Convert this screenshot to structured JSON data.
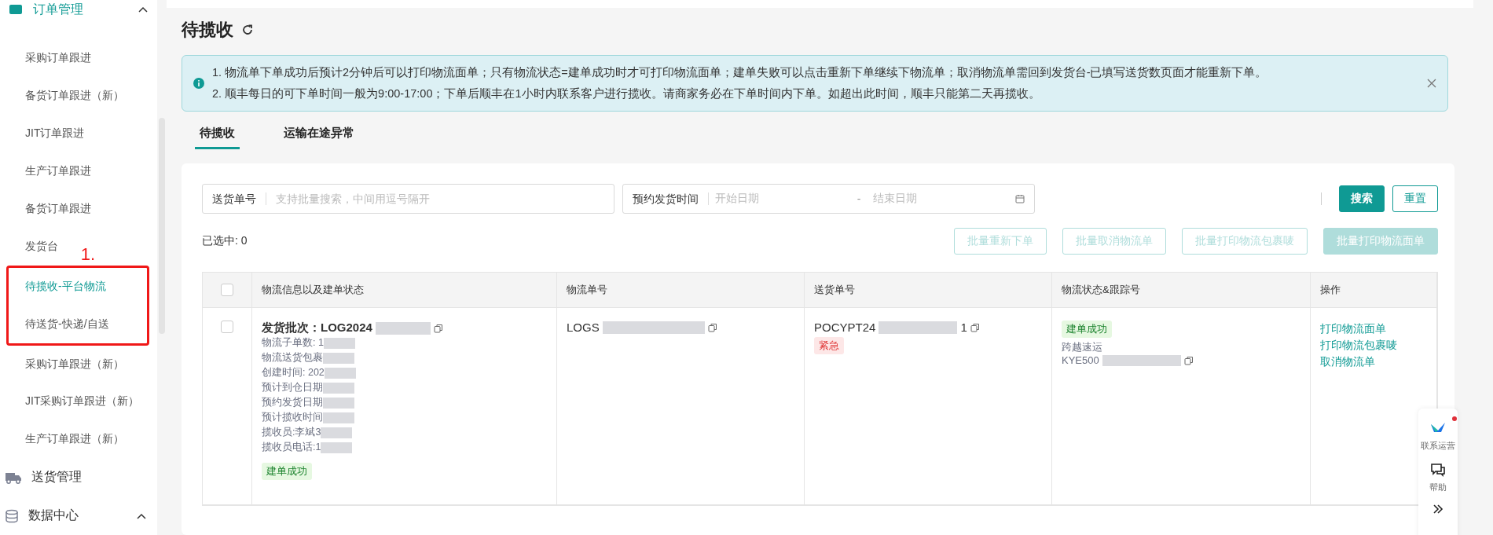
{
  "sidebar": {
    "group_header": {
      "label": "订单管理",
      "expanded": true
    },
    "items": [
      {
        "kind": "link",
        "label": "采购订单跟进",
        "selected": false
      },
      {
        "kind": "link",
        "label": "备货订单跟进（新）",
        "selected": false
      },
      {
        "kind": "link",
        "label": "JIT订单跟进",
        "selected": false
      },
      {
        "kind": "link",
        "label": "生产订单跟进",
        "selected": false
      },
      {
        "kind": "link",
        "label": "备货订单跟进",
        "selected": false
      },
      {
        "kind": "link",
        "label": "发货台",
        "selected": false
      },
      {
        "kind": "annotation",
        "label": "1.",
        "items": [
          {
            "label": "待揽收-平台物流",
            "selected": true
          },
          {
            "label": "待送货-快递/自送",
            "selected": false
          }
        ]
      },
      {
        "kind": "link",
        "label": "采购订单跟进（新）",
        "selected": false
      },
      {
        "kind": "link",
        "label": "JIT采购订单跟进（新）",
        "selected": false
      },
      {
        "kind": "link",
        "label": "生产订单跟进（新）",
        "selected": false
      }
    ],
    "groups": [
      {
        "label": "送货管理",
        "kind": "truck"
      },
      {
        "label": "数据中心",
        "kind": "database",
        "expanded": true
      }
    ]
  },
  "page_title": "待揽收",
  "notice": {
    "lines": [
      "1. 物流单下单成功后预计2分钟后可以打印物流面单；只有物流状态=建单成功时才可打印物流面单；建单失败可以点击重新下单继续下物流单；取消物流单需回到发货台-已填写送货数页面才能重新下单。",
      "2. 顺丰每日的可下单时间一般为9:00-17:00；下单后顺丰在1小时内联系客户进行揽收。请商家务必在下单时间内下单。如超出此时间，顺丰只能第二天再揽收。"
    ]
  },
  "tabs": [
    {
      "label": "待揽收",
      "selected": true
    },
    {
      "label": "运输在途异常",
      "selected": false
    }
  ],
  "filters": [
    {
      "kind": "text",
      "label": "送货单号",
      "placeholder": "支持批量搜索，中间用逗号隔开"
    },
    {
      "kind": "daterange",
      "label": "预约发货时间",
      "start_placeholder": "开始日期",
      "separator": "-",
      "end_placeholder": "结束日期"
    }
  ],
  "search_button": "搜索",
  "reset_button": "重置",
  "selected_count": "已选中: 0",
  "bulk_actions": [
    {
      "label": "批量重新下单",
      "kind": "outline",
      "disabled": true
    },
    {
      "label": "批量取消物流单",
      "kind": "outline",
      "disabled": true
    },
    {
      "label": "批量打印物流包裹唛",
      "kind": "outline",
      "disabled": true
    },
    {
      "label": "批量打印物流面单",
      "kind": "primary",
      "disabled": true
    }
  ],
  "table": {
    "select_all": false,
    "columns": [
      "物流信息以及建单状态",
      "物流单号",
      "送货单号",
      "物流状态&跟踪号",
      "操作"
    ],
    "rows": [
      {
        "selected": false,
        "batch": "发货批次：LOG2024",
        "info_lines": [
          "物流子单数: 1",
          "物流送货包裹",
          "创建时间: 202",
          "预计到仓日期",
          "预约发货日期",
          "预计揽收时间",
          "揽收员:李斌3",
          "揽收员电话:1"
        ],
        "build_status": "建单成功",
        "logistics_no": "LOGS",
        "delivery_no": "POCYPT24",
        "delivery_suffix": "1",
        "urgent_tag": "紧急",
        "status_tag": "建单成功",
        "carrier": "跨越速运",
        "tracking_no": "KYE500",
        "actions": [
          "打印物流面单",
          "打印物流包裹唛",
          "取消物流单"
        ]
      }
    ]
  },
  "float_panel": [
    {
      "kind": "contact",
      "label": "联系运营",
      "notification": true
    },
    {
      "kind": "help",
      "label": "帮助",
      "notification": false
    },
    {
      "kind": "collapse"
    }
  ]
}
